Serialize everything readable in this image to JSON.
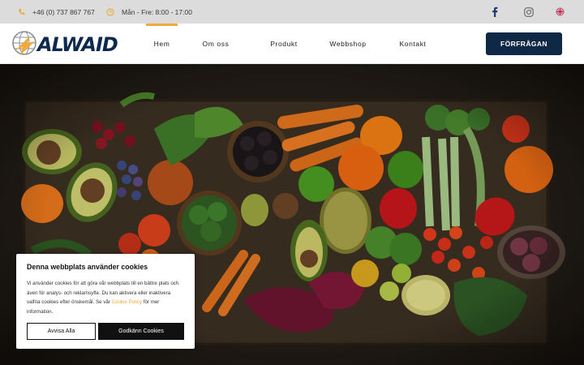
{
  "topbar": {
    "phone": "+46 (0) 737 867 767",
    "hours": "Mån - Fre: 8:00 - 17:00",
    "icons": [
      "phone-icon",
      "clock-icon",
      "facebook-icon",
      "instagram-icon",
      "uk-flag-icon"
    ]
  },
  "brand": {
    "logo_text": "ALWAID"
  },
  "nav": {
    "items": [
      "Hem",
      "Om oss",
      "Produkt",
      "Webbshop",
      "Kontakt"
    ],
    "active": "Hem",
    "cta": "FÖRFRÅGAN"
  },
  "cookie": {
    "title": "Denna webbplats använder cookies",
    "text_before": "Vi använder cookies för att göra vår webbplats till en bättre plats och även för analys- och reklamsyfte. Du kan aktivera eller inaktivera valfria cookies efter önskemål. Se vår ",
    "link": "Cookie Policy",
    "text_after": " för mer information.",
    "deny": "Avvisa Alla",
    "accept": "Godkänn Cookies"
  },
  "colors": {
    "accent": "#f2a93b",
    "navy": "#0f2846",
    "topbar_bg": "#dcdcdc"
  }
}
